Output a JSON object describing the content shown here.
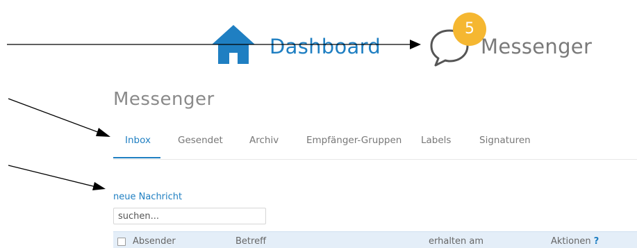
{
  "breadcrumb": {
    "home_icon": "house-icon",
    "dashboard_label": "Dashboard",
    "messenger_icon": "speech-bubble-icon",
    "unread_count": "5",
    "messenger_label": "Messenger",
    "colors": {
      "accent": "#1f7fc2",
      "badge": "#f5b731"
    }
  },
  "page": {
    "title": "Messenger"
  },
  "tabs": [
    {
      "label": "Inbox",
      "active": true
    },
    {
      "label": "Gesendet"
    },
    {
      "label": "Archiv"
    },
    {
      "label": "Empfänger-Gruppen"
    },
    {
      "label": "Labels"
    },
    {
      "label": "Signaturen"
    }
  ],
  "actions": {
    "new_message": "neue Nachricht"
  },
  "search": {
    "placeholder": "suchen..."
  },
  "table": {
    "columns": [
      "Absender",
      "Betreff",
      "erhalten am",
      "Aktionen"
    ],
    "help": "?"
  }
}
